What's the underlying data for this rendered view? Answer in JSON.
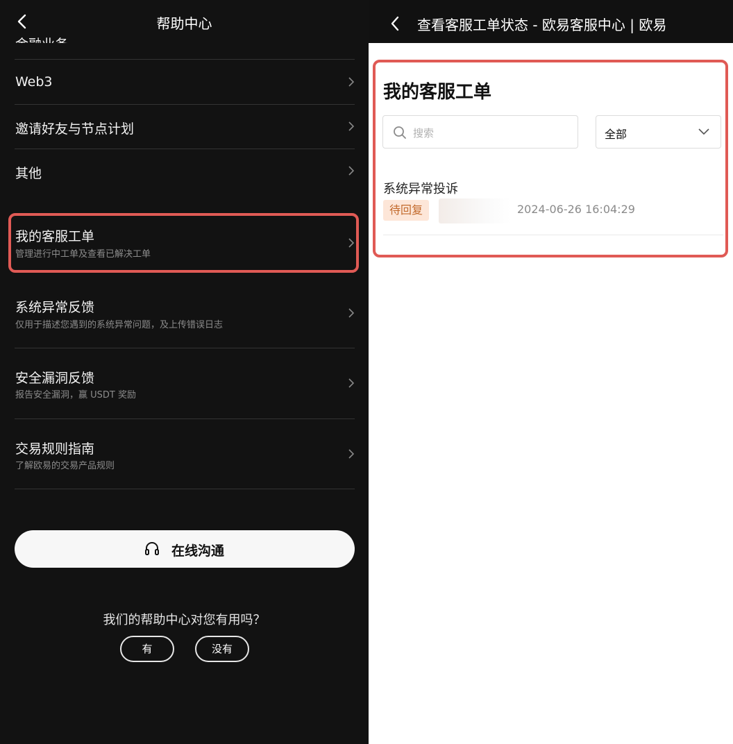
{
  "left_screen": {
    "header_title": "帮助中心",
    "partial_item_label": "金融业务",
    "items": [
      {
        "title": "Web3"
      },
      {
        "title": "邀请好友与节点计划"
      },
      {
        "title": "其他"
      },
      {
        "title": "我的客服工单",
        "subtitle": "管理进行中工单及查看已解决工单"
      },
      {
        "title": "系统异常反馈",
        "subtitle": "仅用于描述您遇到的系统异常问题，及上传错误日志"
      },
      {
        "title": "安全漏洞反馈",
        "subtitle": "报告安全漏洞，赢 USDT 奖励"
      },
      {
        "title": "交易规则指南",
        "subtitle": "了解欧易的交易产品规则"
      }
    ],
    "chat_button_label": "在线沟通",
    "feedback_question": "我们的帮助中心对您有用吗？",
    "yes_label": "有",
    "no_label": "没有"
  },
  "right_screen": {
    "header_title": "查看客服工单状态 - 欧易客服中心 | 欧易",
    "page_title": "我的客服工单",
    "search_placeholder": "搜索",
    "filter_value": "全部",
    "tickets": [
      {
        "title": "系统异常投诉",
        "status": "待回复",
        "time": "2024-06-26 16:04:29"
      }
    ]
  },
  "colors": {
    "highlight": "#e05a55",
    "dark_bg": "#121212",
    "badge_bg": "#fde6d8",
    "badge_text": "#c26a2c"
  },
  "icons": [
    "back-arrow-icon",
    "chevron-right-icon",
    "headset-icon",
    "search-icon",
    "chevron-down-icon"
  ]
}
